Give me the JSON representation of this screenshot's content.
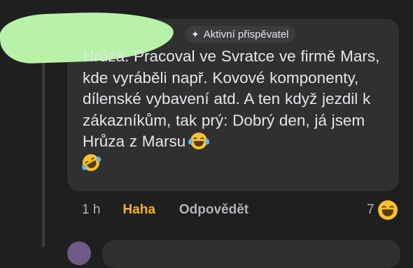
{
  "comment": {
    "badge_label": "Aktivní přispěvatel",
    "badge_icon": "star-icon",
    "text_main": "Hrůza. Pracoval ve Svratce ve firmě Mars, kde vyráběli např. Kovové komponenty, dílenské vybavení atd. A ten když jezdil k zákazníkům, tak prý: Dobrý den, já jsem Hrůza z Marsu",
    "emojis": [
      "face-with-tears-of-joy",
      "rolling-on-the-floor-laughing"
    ],
    "time": "1 h",
    "reaction_label": "Haha",
    "reply_label": "Odpovědět",
    "reaction_count": "7",
    "reaction_icon": "grinning-squinting-face-icon"
  },
  "colors": {
    "background": "#1f1f20",
    "bubble": "#303031",
    "text": "#e4e6eb",
    "muted": "#b0b3b8",
    "haha_accent": "#f7b125",
    "redaction": "#b8f2a8"
  }
}
